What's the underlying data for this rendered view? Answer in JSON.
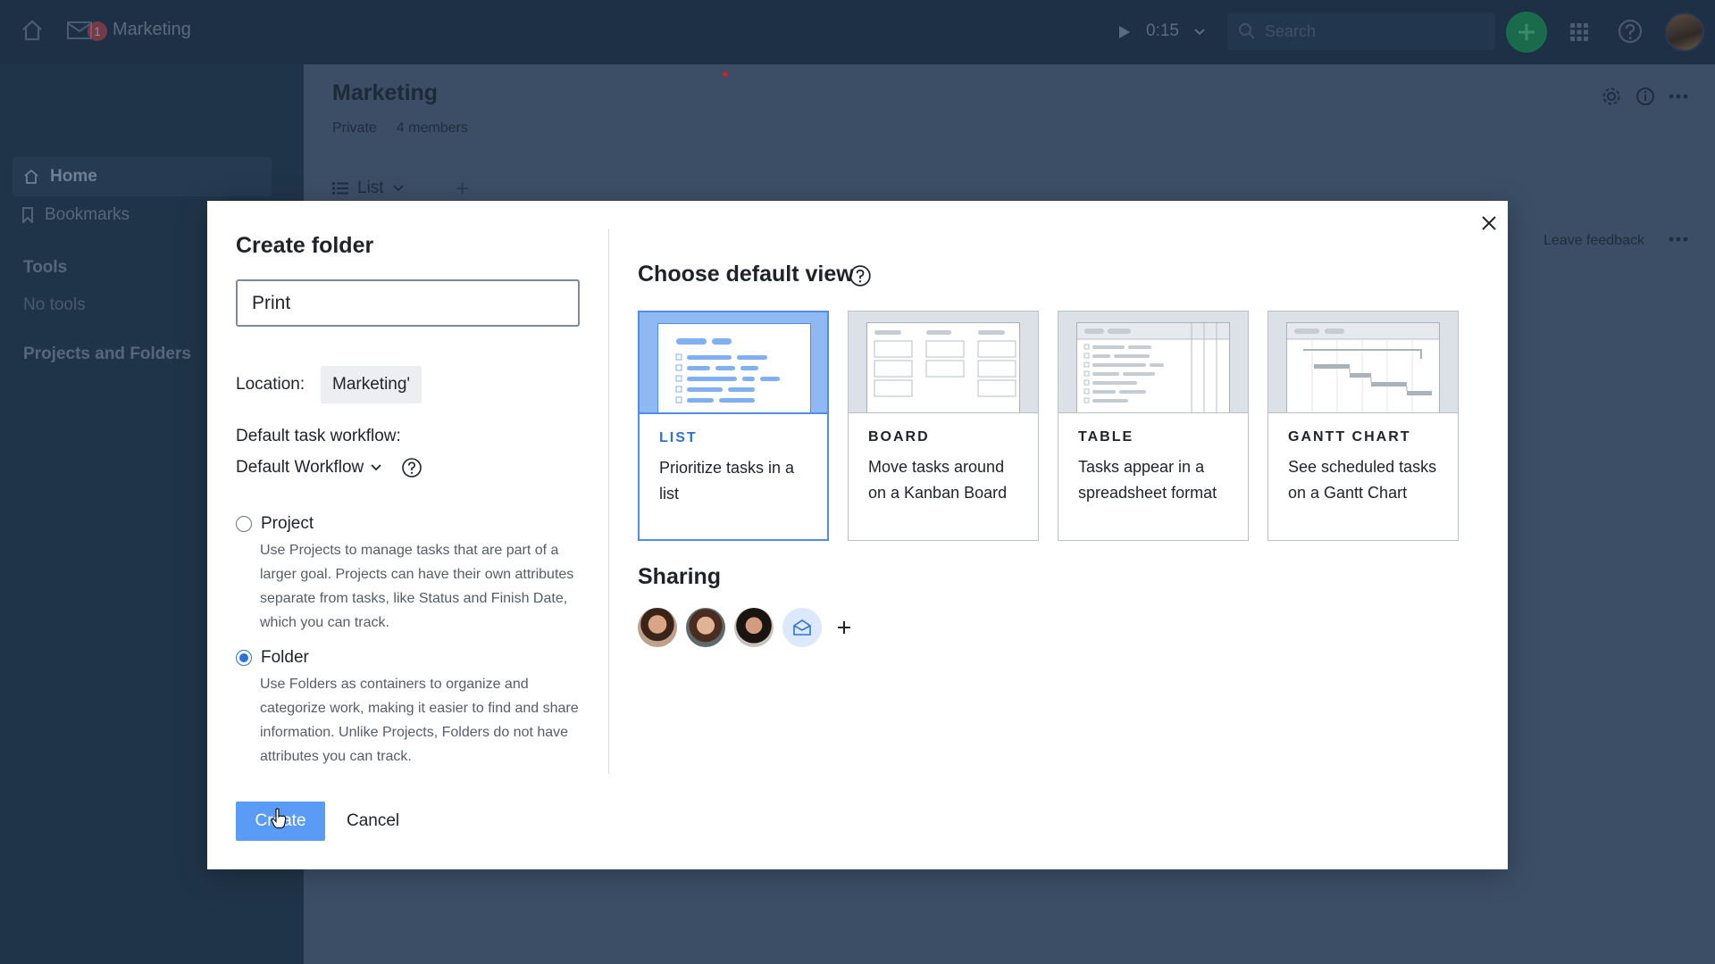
{
  "topbar": {
    "notification_count": "1",
    "space_name": "Marketing",
    "timer": "0:15",
    "search_placeholder": "Search"
  },
  "sidebar": {
    "home": "Home",
    "bookmarks": "Bookmarks",
    "tools_heading": "Tools",
    "no_tools": "No tools",
    "projects_heading": "Projects and Folders"
  },
  "main": {
    "title": "Marketing",
    "privacy": "Private",
    "members": "4 members",
    "view_label": "List",
    "feedback": "Leave feedback"
  },
  "modal": {
    "title": "Create folder",
    "name_value": "Print",
    "location_label": "Location:",
    "location_value": "Marketing'",
    "workflow_label": "Default task workflow:",
    "workflow_value": "Default Workflow",
    "options": [
      {
        "label": "Project",
        "description": "Use Projects to manage tasks that are part of a larger goal. Projects can have their own attributes separate from tasks, like Status and Finish Date, which you can track.",
        "selected": false
      },
      {
        "label": "Folder",
        "description": "Use Folders as containers to organize and categorize work, making it easier to find and share information. Unlike Projects, Folders do not have attributes you can track.",
        "selected": true
      }
    ],
    "create_button": "Create",
    "cancel_button": "Cancel",
    "view_heading": "Choose default view",
    "views": [
      {
        "name": "LIST",
        "description": "Prioritize tasks in a list",
        "selected": true
      },
      {
        "name": "BOARD",
        "description": "Move tasks around on a Kanban Board",
        "selected": false
      },
      {
        "name": "TABLE",
        "description": "Tasks appear in a spreadsheet format",
        "selected": false
      },
      {
        "name": "GANTT CHART",
        "description": "See scheduled tasks on a Gantt Chart",
        "selected": false
      }
    ],
    "sharing_heading": "Sharing"
  },
  "colors": {
    "accent": "#2d72d9",
    "primary_button": "#5a9cf5",
    "topbar": "#1d3046",
    "add_button": "#1a6b4c"
  }
}
